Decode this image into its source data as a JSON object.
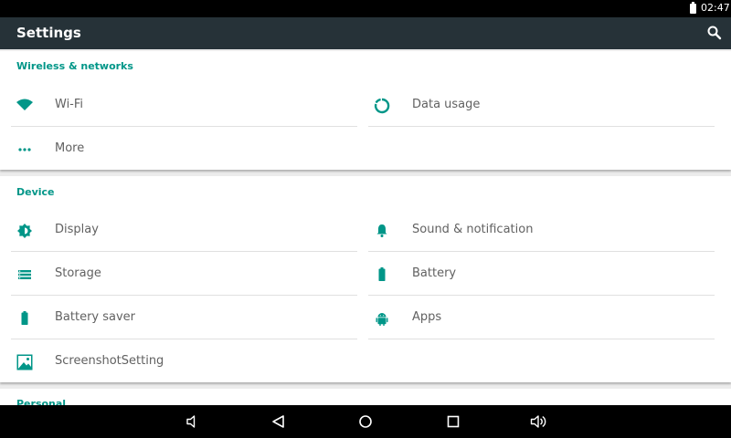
{
  "status_bar": {
    "time": "02:47",
    "battery_icon": "battery-icon"
  },
  "app_bar": {
    "title": "Settings",
    "search_icon": "search-icon"
  },
  "colors": {
    "accent": "#009688",
    "app_bar": "#263238",
    "status_bar": "#000000",
    "text": "#616161",
    "background": "#ececec"
  },
  "sections": [
    {
      "title": "Wireless & networks",
      "items": [
        {
          "label": "Wi-Fi",
          "icon": "wifi-icon"
        },
        {
          "label": "Data usage",
          "icon": "data-usage-icon"
        },
        {
          "label": "More",
          "icon": "more-icon"
        }
      ]
    },
    {
      "title": "Device",
      "items": [
        {
          "label": "Display",
          "icon": "display-icon"
        },
        {
          "label": "Sound & notification",
          "icon": "bell-icon"
        },
        {
          "label": "Storage",
          "icon": "storage-icon"
        },
        {
          "label": "Battery",
          "icon": "battery-icon"
        },
        {
          "label": "Battery saver",
          "icon": "battery-saver-icon"
        },
        {
          "label": "Apps",
          "icon": "android-icon"
        },
        {
          "label": "ScreenshotSetting",
          "icon": "screenshot-icon"
        }
      ]
    },
    {
      "title": "Personal",
      "items": []
    }
  ],
  "nav_bar": {
    "buttons": [
      {
        "icon": "volume-down-icon"
      },
      {
        "icon": "back-icon"
      },
      {
        "icon": "home-icon"
      },
      {
        "icon": "recents-icon"
      },
      {
        "icon": "volume-up-icon"
      }
    ]
  }
}
